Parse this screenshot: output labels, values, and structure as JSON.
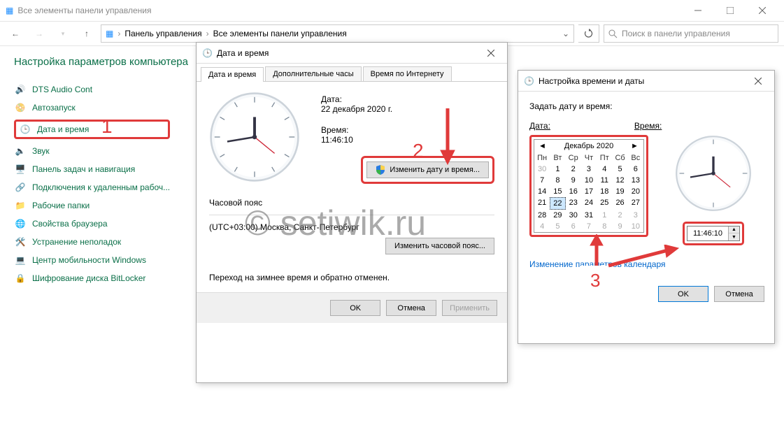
{
  "window": {
    "title": "Все элементы панели управления",
    "breadcrumb": {
      "a": "Панель управления",
      "b": "Все элементы панели управления"
    },
    "search_placeholder": "Поиск в панели управления",
    "heading": "Настройка параметров компьютера"
  },
  "col1": [
    "DTS Audio Cont",
    "Автозапуск",
    "Дата и время",
    "Звук",
    "Панель задач и навигация",
    "Подключения к удаленным рабоч...",
    "Рабочие папки",
    "Свойства браузера",
    "Устранение неполадок",
    "Центр мобильности Windows",
    "Шифрование диска BitLocker"
  ],
  "dt": {
    "title": "Дата и время",
    "tabs": {
      "a": "Дата и время",
      "b": "Дополнительные часы",
      "c": "Время по Интернету"
    },
    "date_label": "Дата:",
    "date_value": "22 декабря 2020 г.",
    "time_label": "Время:",
    "time_value": "11:46:10",
    "change_btn": "Изменить дату и время...",
    "tz_header": "Часовой пояс",
    "tz_value": "(UTC+03:00) Москва, Санкт-Петербург",
    "tz_btn": "Изменить часовой пояс...",
    "dst_note": "Переход на зимнее время и обратно отменен.",
    "ok": "OK",
    "cancel": "Отмена",
    "apply": "Применить"
  },
  "setdt": {
    "title": "Настройка времени и даты",
    "prompt": "Задать дату и время:",
    "date_label": "Дата:",
    "time_label": "Время:",
    "month": "Декабрь 2020",
    "dw": [
      "Пн",
      "Вт",
      "Ср",
      "Чт",
      "Пт",
      "Сб",
      "Вс"
    ],
    "grid": [
      {
        "n": "30",
        "o": 1
      },
      {
        "n": "1"
      },
      {
        "n": "2"
      },
      {
        "n": "3"
      },
      {
        "n": "4"
      },
      {
        "n": "5"
      },
      {
        "n": "6"
      },
      {
        "n": "7"
      },
      {
        "n": "8"
      },
      {
        "n": "9"
      },
      {
        "n": "10"
      },
      {
        "n": "11"
      },
      {
        "n": "12"
      },
      {
        "n": "13"
      },
      {
        "n": "14"
      },
      {
        "n": "15"
      },
      {
        "n": "16"
      },
      {
        "n": "17"
      },
      {
        "n": "18"
      },
      {
        "n": "19"
      },
      {
        "n": "20"
      },
      {
        "n": "21"
      },
      {
        "n": "22",
        "s": 1
      },
      {
        "n": "23"
      },
      {
        "n": "24"
      },
      {
        "n": "25"
      },
      {
        "n": "26"
      },
      {
        "n": "27"
      },
      {
        "n": "28"
      },
      {
        "n": "29"
      },
      {
        "n": "30"
      },
      {
        "n": "31"
      },
      {
        "n": "1",
        "o": 1
      },
      {
        "n": "2",
        "o": 1
      },
      {
        "n": "3",
        "o": 1
      },
      {
        "n": "4",
        "o": 1
      },
      {
        "n": "5",
        "o": 1
      },
      {
        "n": "6",
        "o": 1
      },
      {
        "n": "7",
        "o": 1
      },
      {
        "n": "8",
        "o": 1
      },
      {
        "n": "9",
        "o": 1
      },
      {
        "n": "10",
        "o": 1
      }
    ],
    "time_value": "11:46:10",
    "cal_link": "Изменение параметров календаря",
    "ok": "OK",
    "cancel": "Отмена"
  },
  "annotations": {
    "n1": "1",
    "n2": "2",
    "n3": "3"
  },
  "watermark": "© setiwik.ru"
}
